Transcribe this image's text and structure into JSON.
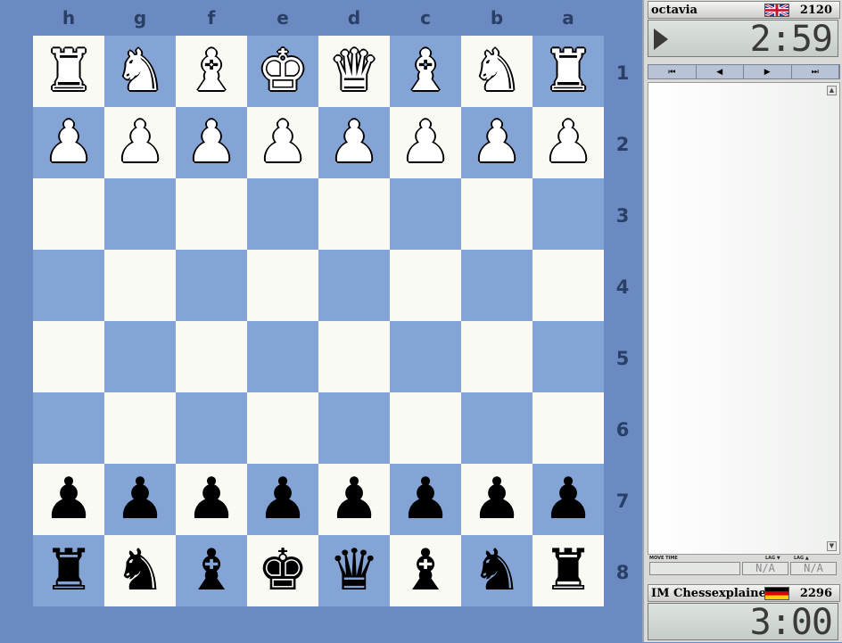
{
  "files": [
    "h",
    "g",
    "f",
    "e",
    "d",
    "c",
    "b",
    "a"
  ],
  "ranks": [
    "1",
    "2",
    "3",
    "4",
    "5",
    "6",
    "7",
    "8"
  ],
  "board": [
    [
      "wR",
      "wN",
      "wB",
      "wK",
      "wQ",
      "wB",
      "wN",
      "wR"
    ],
    [
      "wP",
      "wP",
      "wP",
      "wP",
      "wP",
      "wP",
      "wP",
      "wP"
    ],
    [
      "",
      "",
      "",
      "",
      "",
      "",
      "",
      ""
    ],
    [
      "",
      "",
      "",
      "",
      "",
      "",
      "",
      ""
    ],
    [
      "",
      "",
      "",
      "",
      "",
      "",
      "",
      ""
    ],
    [
      "",
      "",
      "",
      "",
      "",
      "",
      "",
      ""
    ],
    [
      "bP",
      "bP",
      "bP",
      "bP",
      "bP",
      "bP",
      "bP",
      "bP"
    ],
    [
      "bR",
      "bN",
      "bB",
      "bK",
      "bQ",
      "bB",
      "bN",
      "bR"
    ]
  ],
  "piece_glyphs": {
    "K": "♚",
    "Q": "♛",
    "R": "♜",
    "B": "♝",
    "N": "♞",
    "P": "♟"
  },
  "colors": {
    "light_square": "#fafaf5",
    "dark_square": "#84a4d6",
    "background": "#6b8ac2"
  },
  "top_player": {
    "name": "octavia",
    "rating": "2120",
    "flag_icon": "uk-flag-icon",
    "clock": "2:59"
  },
  "bottom_player": {
    "name": "IM Chessexplained",
    "rating": "2296",
    "flag_icon": "germany-flag-icon",
    "clock": "3:00"
  },
  "nav_buttons": [
    {
      "name": "first-move-button",
      "glyph": "⏮"
    },
    {
      "name": "prev-move-button",
      "glyph": "◀"
    },
    {
      "name": "next-move-button",
      "glyph": "▶"
    },
    {
      "name": "last-move-button",
      "glyph": "⏭"
    }
  ],
  "footer": {
    "move_time_label": "MOVE TIME",
    "lag_label_1": "LAG ▼",
    "lag_label_2": "LAG ▲",
    "lag_value_1": "N/A",
    "lag_value_2": "N/A"
  }
}
